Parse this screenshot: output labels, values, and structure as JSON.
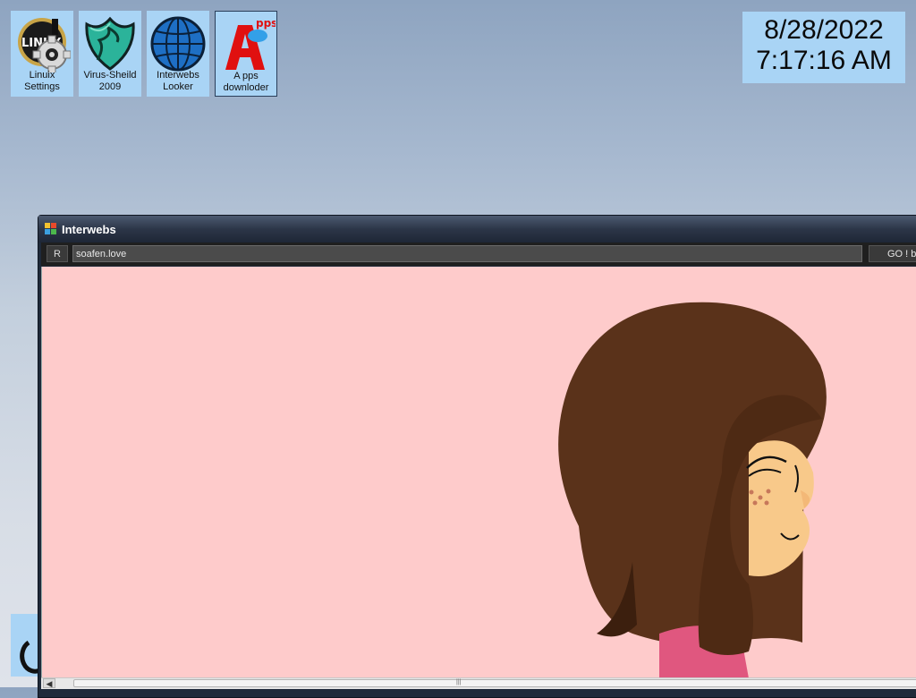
{
  "desktop": {
    "icons": [
      {
        "label": "Linuix\nSettings",
        "logo_text": "LINUX"
      },
      {
        "label": "Virus-Sheild\n2009"
      },
      {
        "label": "Interwebs\nLooker"
      },
      {
        "label": "A pps\ndownloder",
        "logo_text": "pps"
      }
    ]
  },
  "clock": {
    "date": "8/28/2022",
    "time": "7:17:16 AM"
  },
  "browser": {
    "title": "Interwebs",
    "refresh_label": "R",
    "url": "soafen.love",
    "go_label": "GO ! b"
  },
  "colors": {
    "icon_bg": "#a9d4f5",
    "page_bg": "#fecbcb",
    "hair": "#5a321a",
    "skin": "#f8c98a"
  }
}
